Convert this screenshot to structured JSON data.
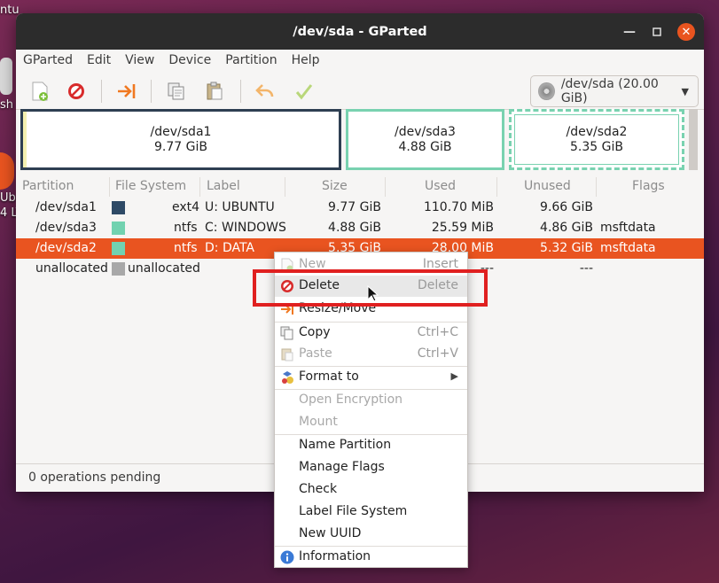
{
  "desktop": {
    "top_label": "ntu",
    "left_labels": [
      "Ubu",
      "4 LT"
    ],
    "trash_label": "sh"
  },
  "window": {
    "title": "/dev/sda - GParted"
  },
  "menubar": [
    "GParted",
    "Edit",
    "View",
    "Device",
    "Partition",
    "Help"
  ],
  "toolbar": {
    "icons": [
      "new-partition-icon",
      "delete-icon",
      "resize-move-icon",
      "copy-icon",
      "paste-icon",
      "undo-icon",
      "apply-icon"
    ],
    "device": "/dev/sda (20.00 GiB)"
  },
  "diskmap": [
    {
      "name": "/dev/sda1",
      "size": "9.77 GiB"
    },
    {
      "name": "/dev/sda3",
      "size": "4.88 GiB"
    },
    {
      "name": "/dev/sda2",
      "size": "5.35 GiB"
    }
  ],
  "table": {
    "headers": [
      "Partition",
      "File System",
      "Label",
      "Size",
      "Used",
      "Unused",
      "Flags"
    ],
    "rows": [
      {
        "partition": "/dev/sda1",
        "fs": "ext4",
        "fs_color": "#2e4a66",
        "label": "U: UBUNTU",
        "size": "9.77 GiB",
        "used": "110.70 MiB",
        "unused": "9.66 GiB",
        "flags": ""
      },
      {
        "partition": "/dev/sda3",
        "fs": "ntfs",
        "fs_color": "#72d2b0",
        "label": "C: WINDOWS",
        "size": "4.88 GiB",
        "used": "25.59 MiB",
        "unused": "4.86 GiB",
        "flags": "msftdata"
      },
      {
        "partition": "/dev/sda2",
        "fs": "ntfs",
        "fs_color": "#72d2b0",
        "label": "D: DATA",
        "size": "5.35 GiB",
        "used": "28.00 MiB",
        "unused": "5.32 GiB",
        "flags": "msftdata"
      },
      {
        "partition": "unallocated",
        "fs": "unallocated",
        "fs_color": "#a8a8a8",
        "label": "",
        "size": "",
        "used": "---",
        "unused": "---",
        "flags": ""
      }
    ]
  },
  "status": "0 operations pending",
  "context_menu": {
    "new": {
      "label": "New",
      "accel": "Insert"
    },
    "delete": {
      "label": "Delete",
      "accel": "Delete"
    },
    "resize": {
      "label": "Resize/Move"
    },
    "copy": {
      "label": "Copy",
      "accel": "Ctrl+C"
    },
    "paste": {
      "label": "Paste",
      "accel": "Ctrl+V"
    },
    "format": {
      "label": "Format to"
    },
    "open_encryption": {
      "label": "Open Encryption"
    },
    "mount": {
      "label": "Mount"
    },
    "name_partition": {
      "label": "Name Partition"
    },
    "manage_flags": {
      "label": "Manage Flags"
    },
    "check": {
      "label": "Check"
    },
    "label_fs": {
      "label": "Label File System"
    },
    "new_uuid": {
      "label": "New UUID"
    },
    "information": {
      "label": "Information"
    }
  },
  "colors": {
    "accent": "#e95420",
    "highlight_box": "#e02020"
  }
}
